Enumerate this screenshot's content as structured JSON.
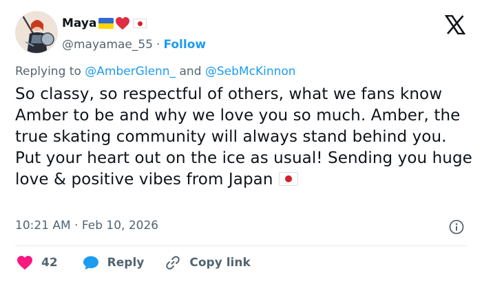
{
  "user": {
    "display_name": "Maya",
    "handle": "@mayamae_55",
    "separator": "·",
    "follow_label": "Follow"
  },
  "reply_context": {
    "prefix": "Replying to",
    "mention_1": "@AmberGlenn_",
    "conjunction": "and",
    "mention_2": "@SebMcKinnon"
  },
  "tweet": {
    "text": "So classy, so respectful of others, what we fans know Amber to be and why we love you so much. Amber, the true skating community will always stand behind you. Put your heart out on the ice as usual! Sending you huge love & positive vibes from Japan",
    "timestamp": "10:21 AM · Feb 10, 2026"
  },
  "actions": {
    "like_count": "42",
    "reply_label": "Reply",
    "copy_link_label": "Copy link"
  },
  "icons": {
    "logo": "x-logo",
    "like": "heart-icon",
    "reply": "speech-bubble-icon",
    "copy_link": "link-icon",
    "info": "info-icon"
  },
  "colors": {
    "accent": "#1d9bf0",
    "like": "#f91880",
    "secondary_text": "#536471",
    "primary_text": "#0f1419"
  }
}
